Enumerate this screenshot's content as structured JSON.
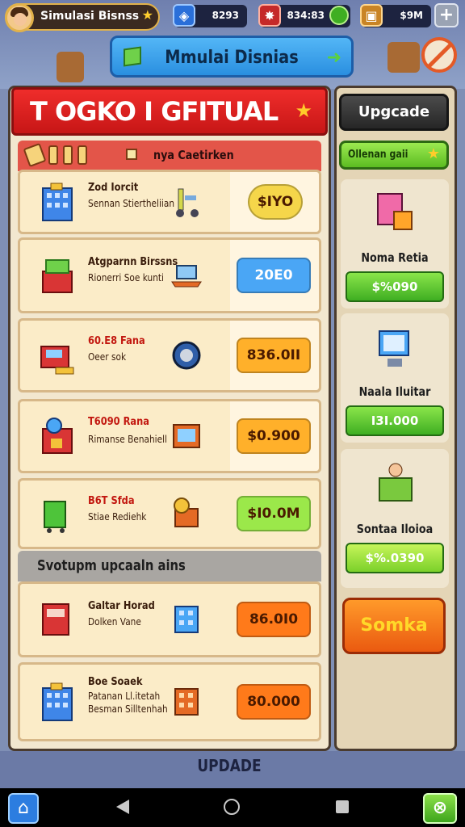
{
  "hud": {
    "profile_name": "Simulasi Bisnss",
    "currency1": "8293",
    "currency2": "834:83",
    "currency3": "$9M",
    "plus": "+"
  },
  "header": {
    "title": "Mmulai Disnias"
  },
  "panel": {
    "title": "T OGKO I GFITUAL",
    "subheader": "nya Caetirken",
    "items": [
      {
        "name": "Zod Iorcit",
        "desc": "Sennan Stiertheliian",
        "price": "$IYO",
        "price_color": "#f5d64a"
      },
      {
        "name": "Atgparnn Birssns",
        "desc": "Rionerri Soe kunti",
        "price": "20E0",
        "price_color": "#4aa6f5"
      },
      {
        "name": "60.E8 Fana",
        "desc": "Oeer sok",
        "price": "836.0II",
        "price_color": "#ffb02a"
      },
      {
        "name": "T6090 Rana",
        "desc": "Rimanse Benahiell",
        "price": "$0.900",
        "price_color": "#ffb02a"
      },
      {
        "name": "B6T Sfda",
        "desc": "Stiae Rediehk",
        "price": "$I0.0M",
        "price_color": "#9be84a"
      }
    ],
    "section_title": "Svotupm upcaaln ains",
    "items2": [
      {
        "name": "Galtar Horad",
        "desc": "Dolken Vane",
        "price": "86.0I0",
        "price_color": "#ff7a1a"
      },
      {
        "name": "Boe Soaek",
        "desc": "Patanan Ll.itetah",
        "desc2": "Besman Silltenhah",
        "price": "80.000",
        "price_color": "#ff7a1a"
      }
    ],
    "bottom_label": "UPDADE"
  },
  "side": {
    "upgrade_label": "Upgcade",
    "green_label": "Ollenan gaii",
    "cards": [
      {
        "name": "Noma Retia",
        "price": "$%090"
      },
      {
        "name": "Naala Iluitar",
        "price": "I3I.000"
      },
      {
        "name": "Sontaa Iloioa",
        "price": "$%.0390"
      }
    ],
    "orange_label": "Somka"
  }
}
